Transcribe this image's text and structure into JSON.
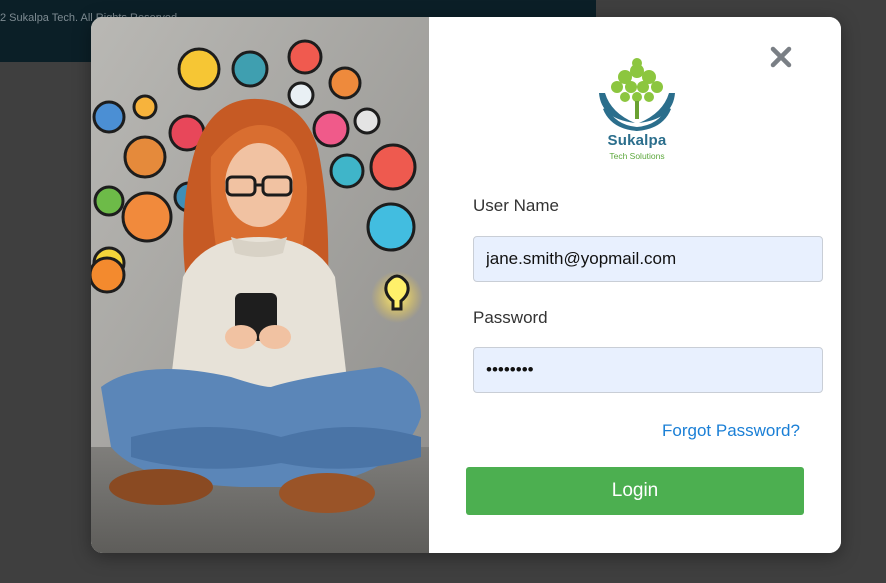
{
  "background": {
    "footer_text": "2 Sukalpa Tech. All Rights Reserved."
  },
  "modal": {
    "close_icon": "close-icon",
    "brand": {
      "name": "Sukalpa",
      "tagline": "Tech Solutions"
    },
    "form": {
      "username_label": "User Name",
      "username_value": "jane.smith@yopmail.com",
      "password_label": "Password",
      "password_value": "••••••••",
      "forgot_link": "Forgot Password?",
      "login_button": "Login"
    }
  },
  "colors": {
    "accent_green": "#4caf50",
    "link_blue": "#1a7fd6",
    "brand_blue": "#2b6e8c",
    "brand_green": "#5da83d",
    "input_fill": "#e8f0fe"
  }
}
